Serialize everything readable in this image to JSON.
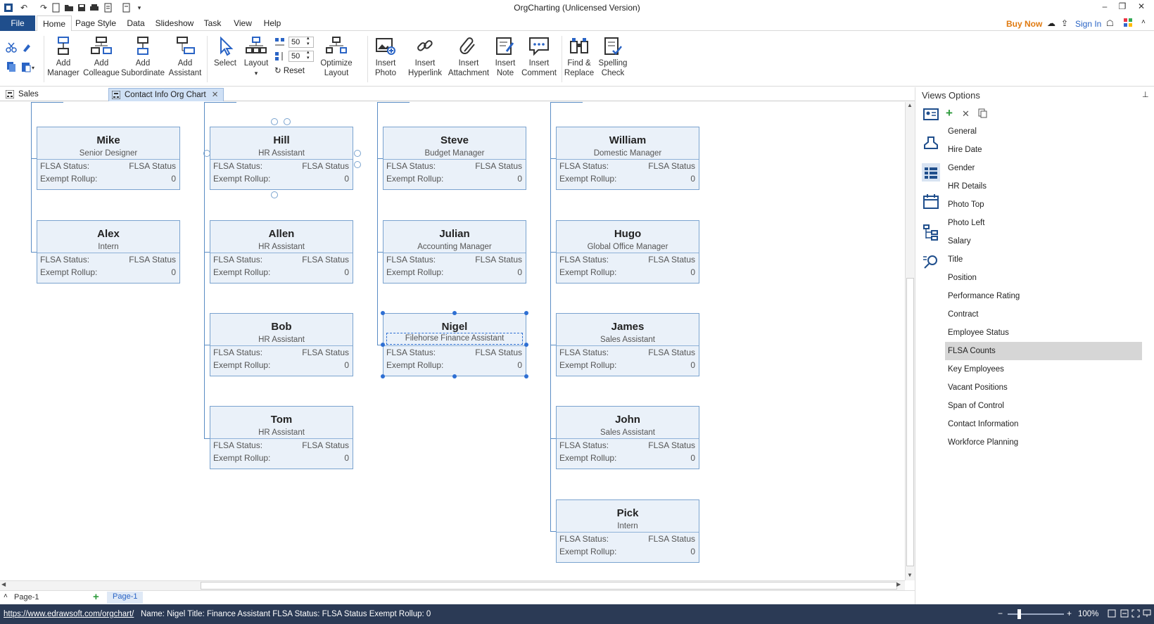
{
  "window": {
    "title": "OrgCharting (Unlicensed Version)"
  },
  "menu": {
    "file": "File",
    "tabs": [
      "Home",
      "Page Style",
      "Data",
      "Slideshow",
      "Task",
      "View",
      "Help"
    ],
    "buy_now": "Buy Now",
    "sign_in": "Sign In"
  },
  "ribbon": {
    "add_manager": [
      "Add",
      "Manager"
    ],
    "add_colleague": [
      "Add",
      "Colleague"
    ],
    "add_subordinate": [
      "Add",
      "Subordinate"
    ],
    "add_assistant": [
      "Add",
      "Assistant"
    ],
    "select": "Select",
    "layout": "Layout",
    "spacing_h": "50",
    "spacing_v": "50",
    "reset": "Reset",
    "optimize": [
      "Optimize",
      "Layout"
    ],
    "insert_photo": [
      "Insert",
      "Photo"
    ],
    "insert_hyperlink": [
      "Insert",
      "Hyperlink"
    ],
    "insert_attachment": [
      "Insert",
      "Attachment"
    ],
    "insert_note": [
      "Insert",
      "Note"
    ],
    "insert_comment": [
      "Insert",
      "Comment"
    ],
    "find_replace": [
      "Find &",
      "Replace"
    ],
    "spelling": [
      "Spelling",
      "Check"
    ]
  },
  "doc_tabs": [
    "Sales Organization...",
    "Contact Info Org Chart"
  ],
  "cards": [
    {
      "name": "Mike",
      "title": "Senior Designer"
    },
    {
      "name": "Alex",
      "title": "Intern"
    },
    {
      "name": "Hill",
      "title": "HR Assistant"
    },
    {
      "name": "Allen",
      "title": "HR Assistant"
    },
    {
      "name": "Bob",
      "title": "HR Assistant"
    },
    {
      "name": "Tom",
      "title": "HR Assistant"
    },
    {
      "name": "Steve",
      "title": "Budget Manager"
    },
    {
      "name": "Julian",
      "title": "Accounting Manager"
    },
    {
      "name": "Nigel",
      "title": "Filehorse Finance Assistant"
    },
    {
      "name": "William",
      "title": "Domestic Manager"
    },
    {
      "name": "Hugo",
      "title": "Global Office Manager"
    },
    {
      "name": "James",
      "title": "Sales Assistant"
    },
    {
      "name": "John",
      "title": "Sales Assistant"
    },
    {
      "name": "Pick",
      "title": "Intern"
    }
  ],
  "card_fields": {
    "flsa_label": "FLSA Status:",
    "flsa_value": "FLSA Status",
    "rollup_label": "Exempt Rollup:",
    "rollup_value": "0"
  },
  "page_tabs": {
    "current": "Page-1",
    "tab": "Page-1"
  },
  "views_panel": {
    "title": "Views Options",
    "items": [
      "General",
      "Hire Date",
      "Gender",
      "HR Details",
      "Photo Top",
      "Photo Left",
      "Salary",
      "Title",
      "Position",
      "Performance Rating",
      "Contract",
      "Employee Status",
      "FLSA Counts",
      "Key Employees",
      "Vacant Positions",
      "Span of Control",
      "Contact Information",
      "Workforce Planning"
    ],
    "selected": "FLSA Counts"
  },
  "status": {
    "link": "https://www.edrawsoft.com/orgchart/",
    "info": "Name: Nigel  Title: Finance Assistant  FLSA Status: FLSA Status  Exempt Rollup: 0",
    "zoom": "100%"
  },
  "colors": {
    "accent": "#1f4e8c",
    "card_bg": "#eaf1f9",
    "card_border": "#7aa3cf",
    "buy_now": "#e07a10",
    "statusbar": "#2b3a55"
  }
}
